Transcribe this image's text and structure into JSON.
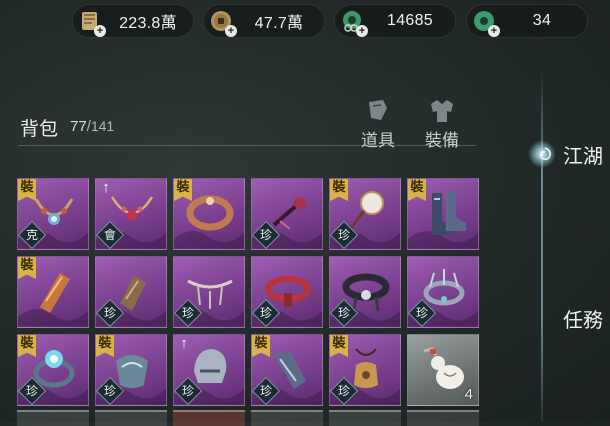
{
  "currencies": [
    {
      "name": "scroll-currency",
      "value": "223.8萬"
    },
    {
      "name": "coin-currency",
      "value": "47.7萬"
    },
    {
      "name": "jade-link-currency",
      "value": "14685"
    },
    {
      "name": "jade-currency",
      "value": "34"
    }
  ],
  "bag": {
    "title": "背包",
    "count": "77",
    "separator": "/",
    "capacity": "141"
  },
  "tabs": [
    {
      "label": "道具"
    },
    {
      "label": "裝備"
    }
  ],
  "side": {
    "jianghu": "江湖",
    "tasks": "任務"
  },
  "slots": [
    {
      "item": "necklace",
      "tag": "裝",
      "badge": "克",
      "quality": "purple"
    },
    {
      "item": "necklace-red",
      "tag": "↑",
      "badge": "會",
      "quality": "purple"
    },
    {
      "item": "bracelet",
      "tag": "裝",
      "badge": "",
      "quality": "purple"
    },
    {
      "item": "hairpin",
      "tag": "",
      "badge": "珍",
      "quality": "purple"
    },
    {
      "item": "fan",
      "tag": "裝",
      "badge": "珍",
      "quality": "purple"
    },
    {
      "item": "boots",
      "tag": "裝",
      "badge": "",
      "quality": "purple"
    },
    {
      "item": "bracer",
      "tag": "裝",
      "badge": "",
      "quality": "purple"
    },
    {
      "item": "gauntlet",
      "tag": "",
      "badge": "珍",
      "quality": "purple"
    },
    {
      "item": "chain-belt",
      "tag": "",
      "badge": "珍",
      "quality": "purple"
    },
    {
      "item": "belt-red",
      "tag": "",
      "badge": "珍",
      "quality": "purple"
    },
    {
      "item": "belt-dark",
      "tag": "",
      "badge": "珍",
      "quality": "purple"
    },
    {
      "item": "crown",
      "tag": "",
      "badge": "珍",
      "quality": "purple"
    },
    {
      "item": "ring",
      "tag": "裝",
      "badge": "珍",
      "quality": "purple"
    },
    {
      "item": "armguard",
      "tag": "裝",
      "badge": "珍",
      "quality": "purple"
    },
    {
      "item": "helmet",
      "tag": "↑",
      "badge": "珍",
      "quality": "purple"
    },
    {
      "item": "leg-armor",
      "tag": "裝",
      "badge": "珍",
      "quality": "purple"
    },
    {
      "item": "pouch",
      "tag": "裝",
      "badge": "珍",
      "quality": "purple"
    },
    {
      "item": "gourd",
      "tag": "",
      "badge": "",
      "quantity": "4",
      "quality": "white"
    }
  ],
  "colors": {
    "purple": "#8a4ca0",
    "gold_tag": "#d9b24a",
    "jade": "#3e9a6a",
    "line_glow": "#aadce6"
  }
}
